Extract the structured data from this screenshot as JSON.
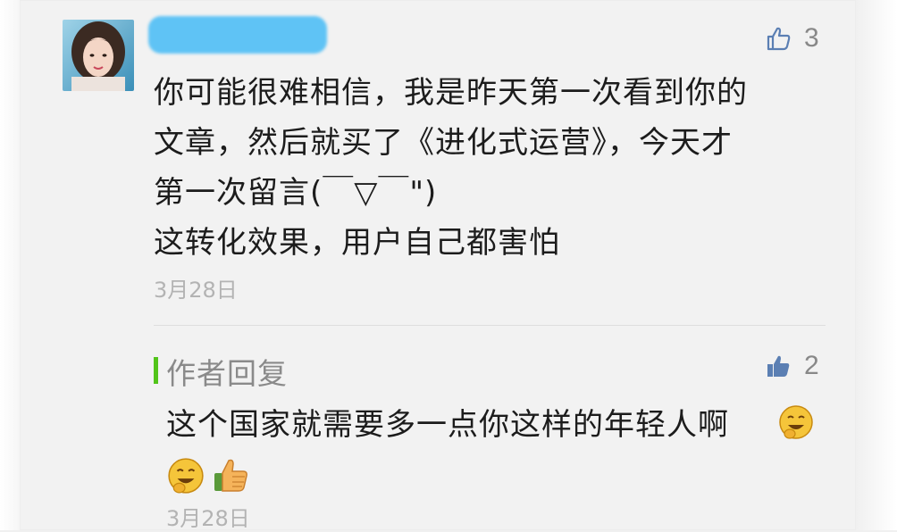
{
  "comment": {
    "like_count": "3",
    "lines": [
      "你可能很难相信，我是昨天第一次看到你的",
      "文章，然后就买了《进化式运营》，今天才",
      "第一次留言(￣▽￣\")",
      "这转化效果，用户自己都害怕"
    ],
    "date": "3月28日"
  },
  "reply": {
    "label": "作者回复",
    "like_count": "2",
    "text": "这个国家就需要多一点你这样的年轻人啊",
    "date": "3月28日",
    "emojis": [
      "grin-emoji",
      "grin-emoji",
      "thumbs-up-emoji"
    ]
  },
  "colors": {
    "reply_accent": "#52c41a",
    "like_icon": "#5b7fb3",
    "redaction": "#5fc3f5"
  }
}
